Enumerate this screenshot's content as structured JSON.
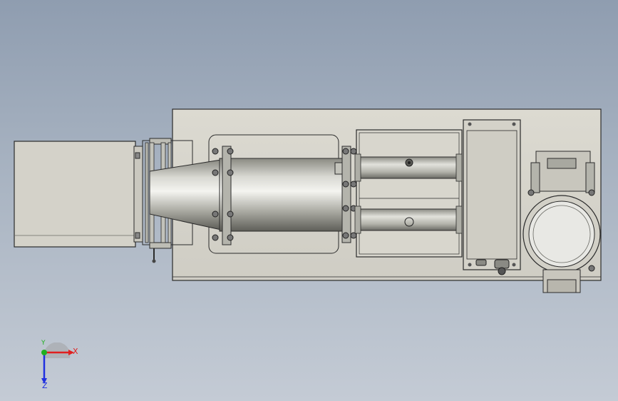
{
  "viewport": {
    "background_top": "#8f9db0",
    "background_bottom": "#c4cbd5"
  },
  "model": {
    "plate_color": "#d6d4cb",
    "edge_color": "#2b2b2b",
    "metal_color": "#c9c9c4"
  },
  "triad": {
    "x_label": "X",
    "y_label": "Y",
    "z_label": "Z",
    "x_color": "#e02020",
    "y_color": "#20b020",
    "z_color": "#2030e0"
  }
}
